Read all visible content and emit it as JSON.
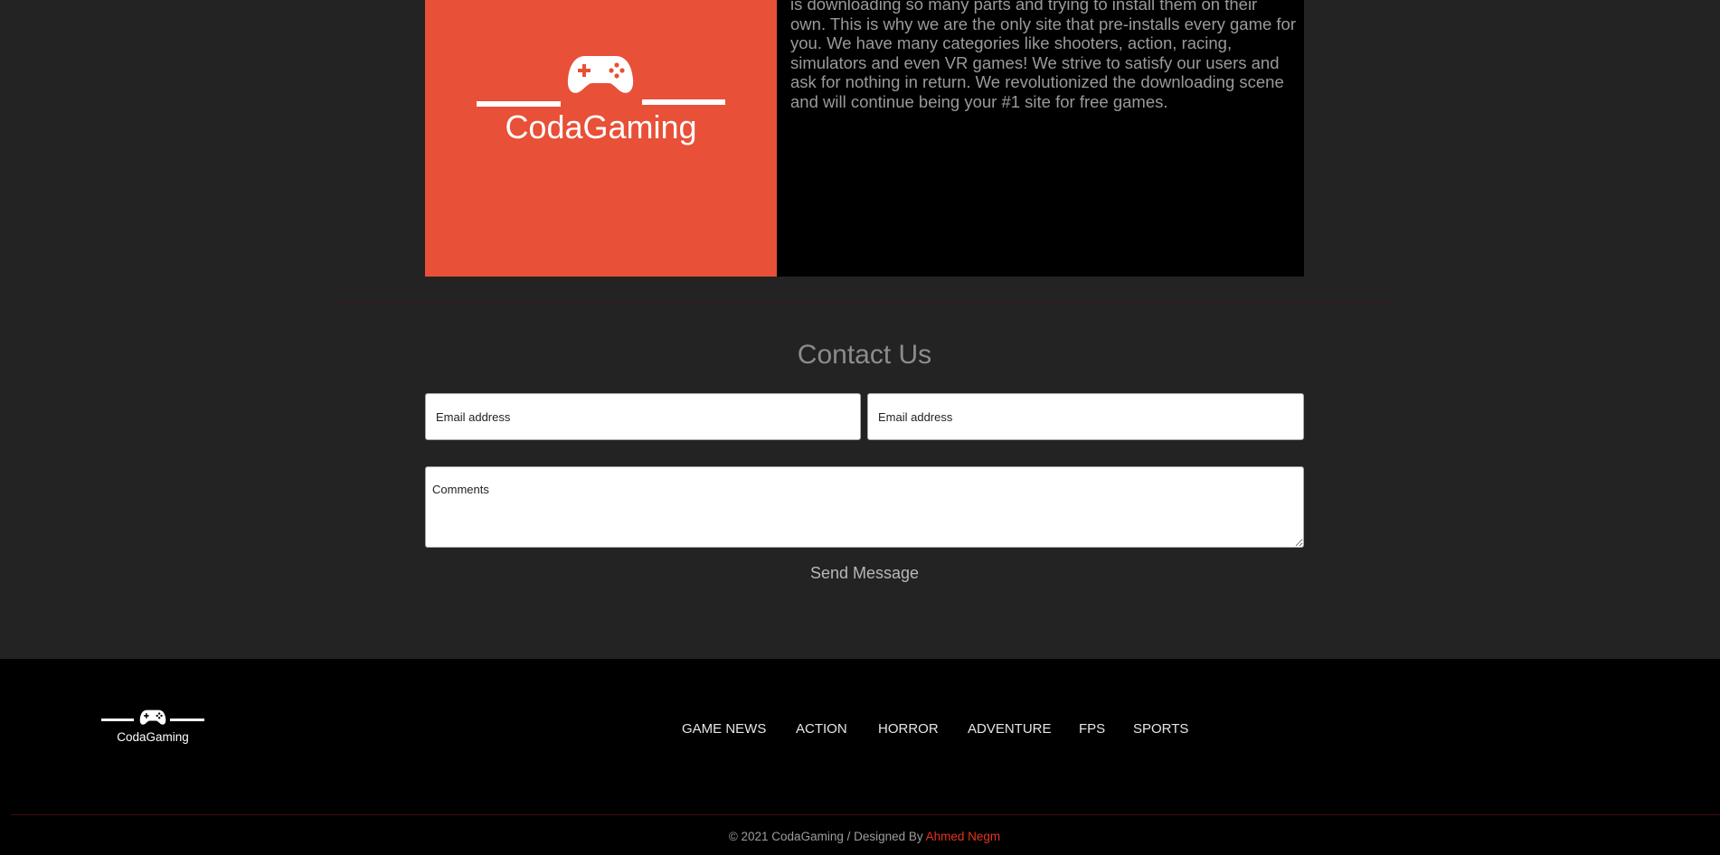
{
  "about": {
    "brand_name": "CodaGaming",
    "paragraph": "is downloading so many parts and trying to install them on their own. This is why we are the only site that pre-installs every game for you. We have many categories like shooters, action, racing, simulators and even VR games! We strive to satisfy our users and ask for nothing in return. We revolutionized the downloading scene and will continue being your #1 site for free games."
  },
  "contact": {
    "title": "Contact Us",
    "field1_placeholder": "Email address",
    "field2_placeholder": "Email address",
    "comments_placeholder": "Comments",
    "send_label": "Send Message"
  },
  "footer": {
    "brand_name": "CodaGaming",
    "nav": [
      "GAME NEWS",
      "ACTION",
      "HORROR",
      "ADVENTURE",
      "FPS",
      "SPORTS"
    ],
    "copyright_prefix": "© 2021 CodaGaming / Designed By ",
    "designer": "Ahmed Negm"
  },
  "colors": {
    "accent": "#e85037",
    "designer_link": "#e8321f",
    "page_bg": "#232323"
  },
  "icons": {
    "logo": "gamepad-icon"
  }
}
